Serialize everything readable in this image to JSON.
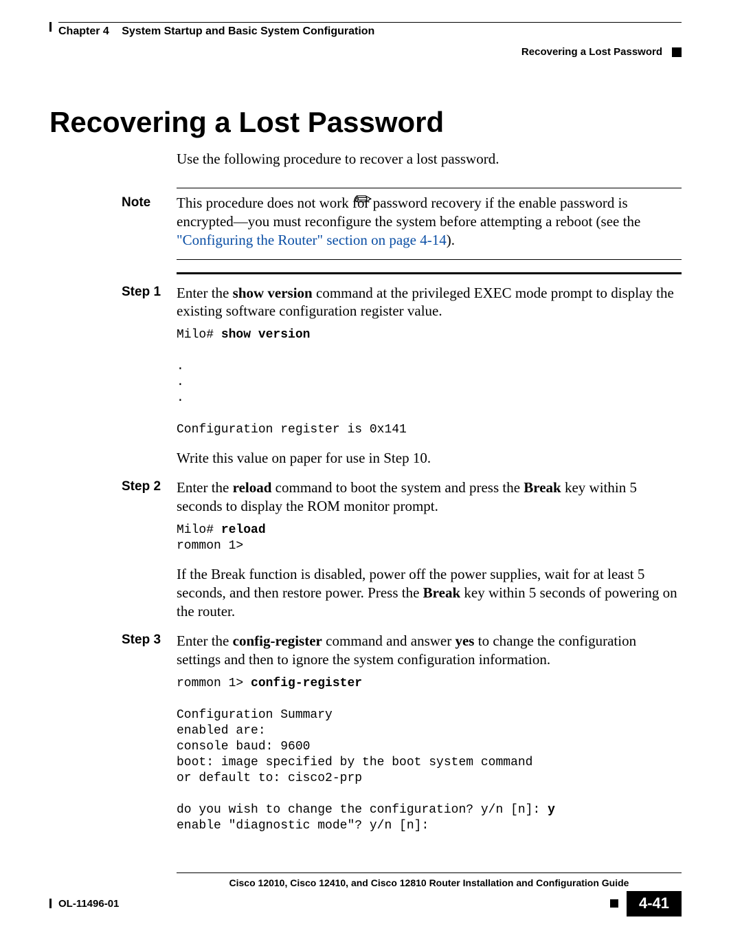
{
  "header": {
    "chapter_num": "Chapter 4",
    "chapter_title": "System Startup and Basic System Configuration",
    "section": "Recovering a Lost Password"
  },
  "title": "Recovering a Lost Password",
  "intro": "Use the following procedure to recover a lost password.",
  "note": {
    "label": "Note",
    "text_before_link": "This procedure does not work for password recovery if the enable password is encrypted—you must reconfigure the system before attempting a reboot (see the ",
    "link_text": "\"Configuring the Router\" section on page 4-14",
    "text_after_link": ")."
  },
  "steps": {
    "s1": {
      "label": "Step 1",
      "para1_a": "Enter the ",
      "para1_cmd": "show version",
      "para1_b": " command at the privileged EXEC mode prompt to display the existing software configuration register value.",
      "code1_prompt": "Milo# ",
      "code1_cmd": "show version",
      "code1_rest": "\n\n.\n.\n.\n\nConfiguration register is 0x141",
      "para2": "Write this value on paper for use in Step 10."
    },
    "s2": {
      "label": "Step 2",
      "para1_a": "Enter the ",
      "para1_cmd": "reload",
      "para1_b": " command to boot the system and press the ",
      "para1_cmd2": "Break",
      "para1_c": " key within 5 seconds to display the ROM monitor prompt.",
      "code1_prompt": "Milo# ",
      "code1_cmd": "reload",
      "code1_rest": "\nrommon 1>",
      "para2_a": "If the Break function is disabled, power off the power supplies, wait for at least 5 seconds, and then restore power. Press the ",
      "para2_cmd": "Break",
      "para2_b": " key within 5 seconds of powering on the router."
    },
    "s3": {
      "label": "Step 3",
      "para1_a": "Enter the ",
      "para1_cmd": "config-register",
      "para1_b": " command and answer ",
      "para1_cmd2": "yes",
      "para1_c": " to change the configuration settings and then to ignore the system configuration information.",
      "code1_prompt": "rommon 1> ",
      "code1_cmd": "config-register",
      "code1_rest": "\n\nConfiguration Summary\nenabled are:\nconsole baud: 9600\nboot: image specified by the boot system command\nor default to: cisco2-prp\n\ndo you wish to change the configuration? y/n [n]: ",
      "code1_ans": "y",
      "code1_rest2": "\nenable \"diagnostic mode\"? y/n [n]:"
    }
  },
  "footer": {
    "guide": "Cisco 12010, Cisco 12410, and Cisco 12810 Router Installation and Configuration Guide",
    "docnum": "OL-11496-01",
    "pagenum": "4-41"
  }
}
